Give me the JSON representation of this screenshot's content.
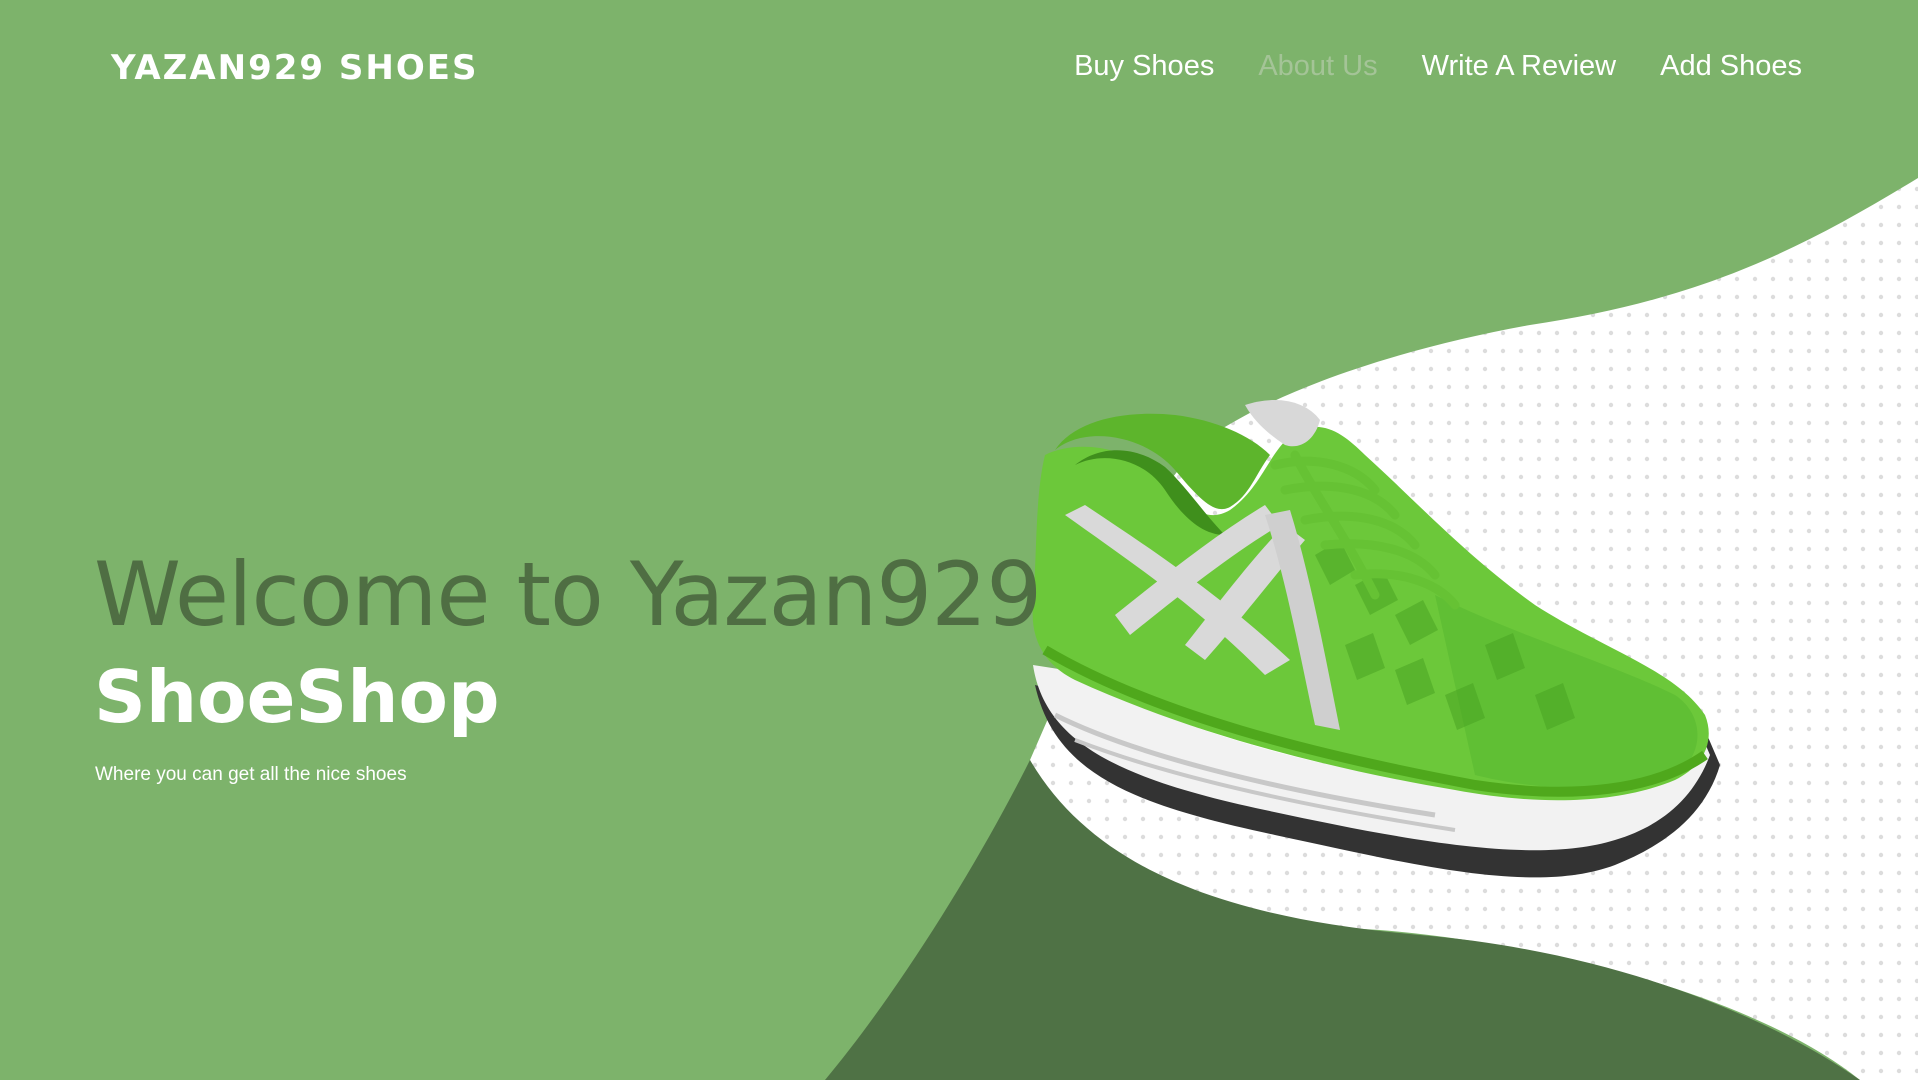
{
  "header": {
    "brand": "YAZAN929 SHOES",
    "nav": [
      {
        "label": "Buy Shoes",
        "active": false
      },
      {
        "label": "About Us",
        "active": true
      },
      {
        "label": "Write A Review",
        "active": false
      },
      {
        "label": "Add Shoes",
        "active": false
      }
    ]
  },
  "hero": {
    "title": "Welcome to Yazan929",
    "subtitle": "ShoeShop",
    "tagline": "Where you can get all the nice shoes",
    "image": "green-running-shoe"
  },
  "colors": {
    "background": "#7db36b",
    "dark_wave": "#4f7245",
    "title_text": "#4f6e43",
    "active_nav": "#a4c497",
    "shoe_green": "#6cc83a"
  }
}
